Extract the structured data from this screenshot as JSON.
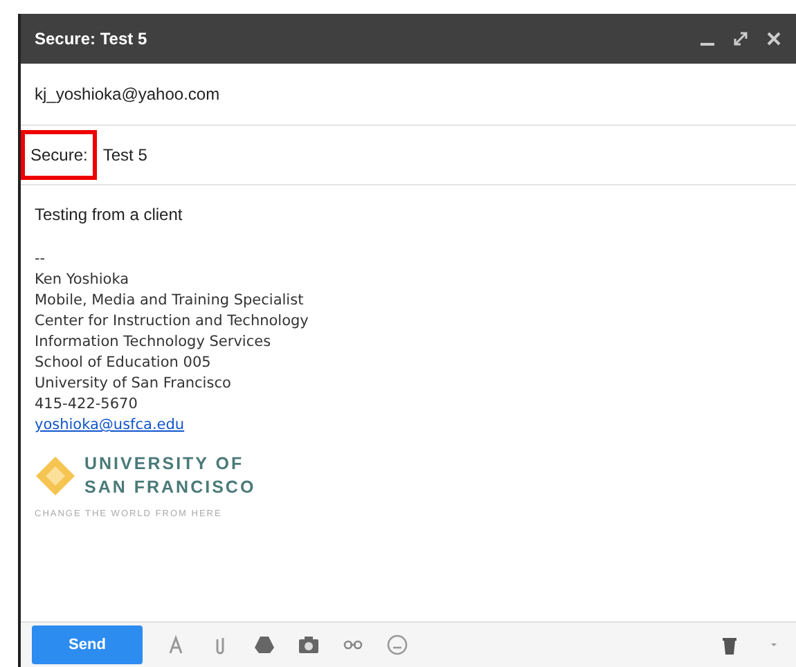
{
  "window": {
    "title": "Secure: Test 5"
  },
  "to": {
    "value": "kj_yoshioka@yahoo.com"
  },
  "subject": {
    "prefix": "Secure:",
    "text": "Test 5",
    "highlighted": true
  },
  "body": {
    "message": "Testing from a client",
    "separator": "--",
    "signature": [
      "Ken Yoshioka",
      "Mobile, Media and Training Specialist",
      "Center for Instruction and Technology",
      "Information Technology Services",
      "School of Education 005",
      "University of San Francisco",
      "415-422-5670"
    ],
    "email_link": "yoshioka@usfca.edu",
    "logo": {
      "line_1": "UNIVERSITY OF",
      "line_2": "SAN FRANCISCO",
      "tagline": "CHANGE THE WORLD FROM HERE"
    }
  },
  "toolbar": {
    "send": "Send"
  }
}
